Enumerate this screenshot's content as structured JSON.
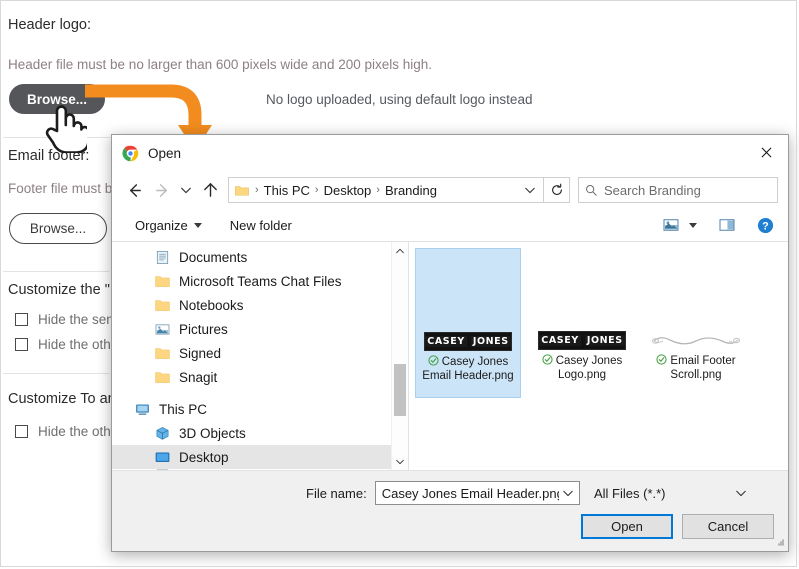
{
  "background_page": {
    "header_logo_label": "Header logo:",
    "header_hint": "Header file must be no larger than 600 pixels wide and 200 pixels high.",
    "header_browse_label": "Browse...",
    "header_status": "No logo uploaded, using default logo instead",
    "email_footer_label": "Email footer:",
    "footer_hint": "Footer file must b",
    "footer_browse_label": "Browse...",
    "customize_from_label": "Customize the \"",
    "customize_to_label": "Customize To an",
    "checkboxes": [
      {
        "label": "Hide the send"
      },
      {
        "label": "Hide the othe"
      },
      {
        "label": "Hide the othe"
      }
    ]
  },
  "dialog": {
    "title": "Open",
    "title_icon": "chrome-icon",
    "close_icon": "close-icon",
    "nav": {
      "back_icon": "arrow-left-icon",
      "forward_icon": "arrow-right-icon",
      "recent_icon": "chevron-down-icon",
      "up_icon": "arrow-up-icon",
      "folder_icon": "folder-icon",
      "breadcrumbs": [
        "This PC",
        "Desktop",
        "Branding"
      ],
      "breadcrumb_separator": "›",
      "address_caret_icon": "chevron-down-icon",
      "refresh_icon": "refresh-icon",
      "search_icon": "search-icon",
      "search_placeholder": "Search Branding"
    },
    "toolbar": {
      "organize_label": "Organize",
      "organize_caret_icon": "caret-down-icon",
      "new_folder_label": "New folder",
      "view_icon": "view-layout-icon",
      "view_caret_icon": "caret-down-icon",
      "preview_pane_icon": "preview-pane-icon",
      "help_icon": "help-icon"
    },
    "tree": {
      "groups": [
        {
          "items": [
            {
              "label": "Documents",
              "icon": "documents-icon",
              "level": 1,
              "selected": false
            },
            {
              "label": "Microsoft Teams Chat Files",
              "icon": "folder-icon",
              "level": 1,
              "selected": false
            },
            {
              "label": "Notebooks",
              "icon": "folder-icon",
              "level": 1,
              "selected": false
            },
            {
              "label": "Pictures",
              "icon": "pictures-icon",
              "level": 1,
              "selected": false
            },
            {
              "label": "Signed",
              "icon": "folder-icon",
              "level": 1,
              "selected": false
            },
            {
              "label": "Snagit",
              "icon": "folder-icon",
              "level": 1,
              "selected": false
            }
          ]
        },
        {
          "items": [
            {
              "label": "This PC",
              "icon": "computer-icon",
              "level": 0,
              "selected": false
            },
            {
              "label": "3D Objects",
              "icon": "3d-objects-icon",
              "level": 1,
              "selected": false
            },
            {
              "label": "Desktop",
              "icon": "desktop-icon",
              "level": 1,
              "selected": true
            }
          ]
        }
      ],
      "scrollbar": {
        "up_icon": "chevron-up-icon",
        "down_icon": "chevron-down-icon"
      }
    },
    "files": [
      {
        "name": "Casey Jones Email Header.png",
        "thumb": "casey-jones-banner",
        "words": [
          "CASEY",
          "JONES"
        ],
        "status_icon": "sync-ok-icon",
        "selected": true
      },
      {
        "name": "Casey Jones Logo.png",
        "thumb": "casey-jones-banner",
        "words": [
          "CASEY",
          "JONES"
        ],
        "status_icon": "sync-ok-icon",
        "selected": false
      },
      {
        "name": "Email Footer Scroll.png",
        "thumb": "scroll-divider",
        "words": [],
        "status_icon": "sync-ok-icon",
        "selected": false
      }
    ],
    "footer": {
      "file_name_label": "File name:",
      "file_name_value": "Casey Jones Email Header.png",
      "file_name_caret_icon": "chevron-down-icon",
      "filter_value": "All Files (*.*)",
      "filter_caret_icon": "chevron-down-icon",
      "open_label": "Open",
      "cancel_label": "Cancel",
      "resize_grip_icon": "resize-grip-icon"
    }
  },
  "annotation": {
    "arrow_icon": "callout-arrow-icon",
    "arrow_color": "#f28c1e",
    "cursor_icon": "hand-pointer-cursor"
  },
  "colors": {
    "accent_blue": "#0078d7",
    "selection_blue": "#cce4f7",
    "annotation_orange": "#f28c1e",
    "hint_text": "#8d7f86",
    "primary_btn": "#55565a"
  }
}
